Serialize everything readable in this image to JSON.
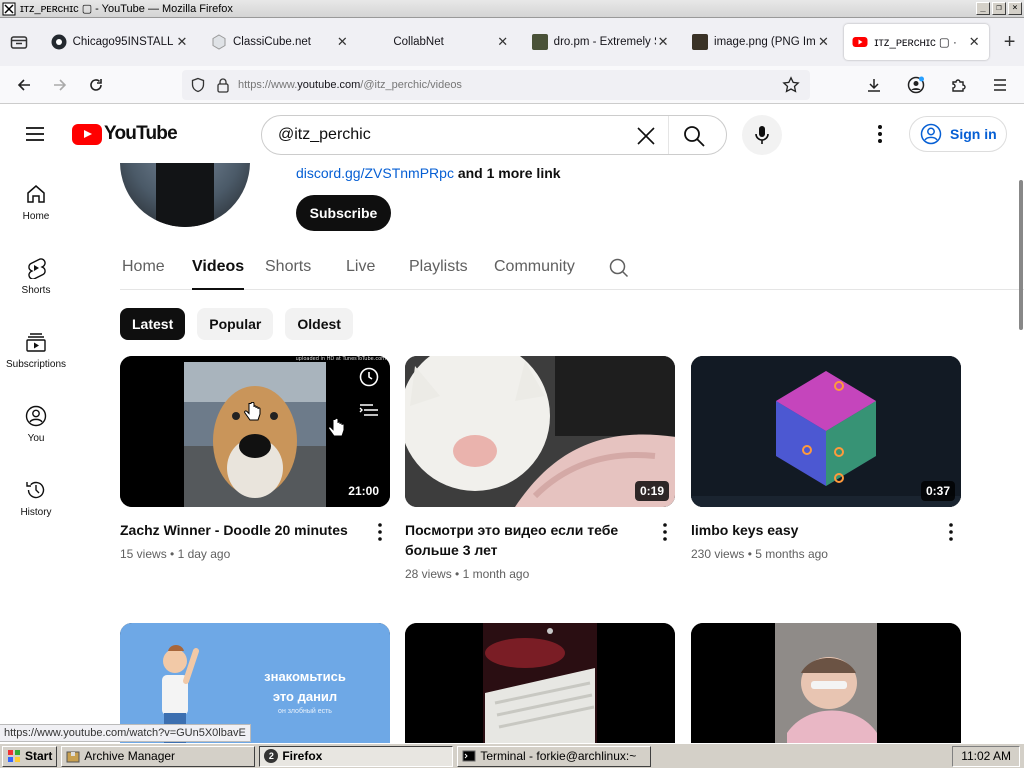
{
  "window": {
    "title": "ɪᴛᴢ_ᴘᴇʀᴄʜɪᴄ ▢ - YouTube — Mozilla Firefox",
    "buttons": [
      "_",
      "❐",
      "×"
    ]
  },
  "tabs": [
    {
      "label": "Chicago95INSTALL",
      "favicon_color": "#24292f",
      "icon": "github-icon"
    },
    {
      "label": "ClassiCube.net",
      "favicon_color": "#cfd3d8",
      "icon": "cube-icon"
    },
    {
      "label": "CollabNet",
      "favicon_color": "#ffffff",
      "icon": "blank-page-icon"
    },
    {
      "label": "dro.pm - Extremely Sl",
      "favicon_color": "#4a5238",
      "icon": "image-thumbnail-icon"
    },
    {
      "label": "image.png (PNG Ima",
      "favicon_color": "#3a3226",
      "icon": "image-thumbnail-icon"
    },
    {
      "label": "ɪᴛᴢ_ᴘᴇʀᴄʜɪᴄ ▢ ·",
      "favicon_color": "#ff0000",
      "icon": "youtube-icon",
      "active": true
    }
  ],
  "navbar": {
    "url_prefix": "https://www.",
    "url_domain": "youtube.com",
    "url_path": "/@itz_perchic/videos"
  },
  "youtube": {
    "logo_text": "YouTube",
    "search_value": "@itz_perchic",
    "signin_label": "Sign in"
  },
  "sidebar": [
    {
      "label": "Home",
      "icon": "home-icon"
    },
    {
      "label": "Shorts",
      "icon": "shorts-icon"
    },
    {
      "label": "Subscriptions",
      "icon": "subscriptions-icon"
    },
    {
      "label": "You",
      "icon": "you-icon"
    },
    {
      "label": "History",
      "icon": "history-icon"
    }
  ],
  "channel": {
    "link_text": "discord.gg/ZVSTnmPRpc",
    "more_links": "and 1 more link",
    "subscribe_label": "Subscribe",
    "tabs": [
      "Home",
      "Videos",
      "Shorts",
      "Live",
      "Playlists",
      "Community"
    ],
    "active_tab": "Videos"
  },
  "chips": [
    {
      "label": "Latest",
      "active": true
    },
    {
      "label": "Popular"
    },
    {
      "label": "Oldest"
    }
  ],
  "videos": [
    {
      "title": "Zachz Winner - Doodle 20 minutes",
      "views": "15 views",
      "age": "1 day ago",
      "duration": "21:00",
      "thumb_caption": "uploaded in HD at TunesToTube.com"
    },
    {
      "title": "Посмотри это видео если тебе больше 3 лет",
      "views": "28 views",
      "age": "1 month ago",
      "duration": "0:19"
    },
    {
      "title": "limbo keys easy",
      "views": "230 views",
      "age": "5 months ago",
      "duration": "0:37"
    },
    {
      "title": "",
      "thumb_text_1": "знакомьтись",
      "thumb_text_2": "это данил",
      "thumb_text_3": "он злобный есть"
    },
    {
      "title": ""
    },
    {
      "title": ""
    }
  ],
  "status_url": "https://www.youtube.com/watch?v=GUn5X0lbavE",
  "taskbar": {
    "start": "Start",
    "items": [
      {
        "label": "Archive Manager"
      },
      {
        "label": "Firefox",
        "badge": "2",
        "pressed": true
      },
      {
        "label": "Terminal - forkie@archlinux:~"
      }
    ],
    "clock": "11:02 AM"
  }
}
